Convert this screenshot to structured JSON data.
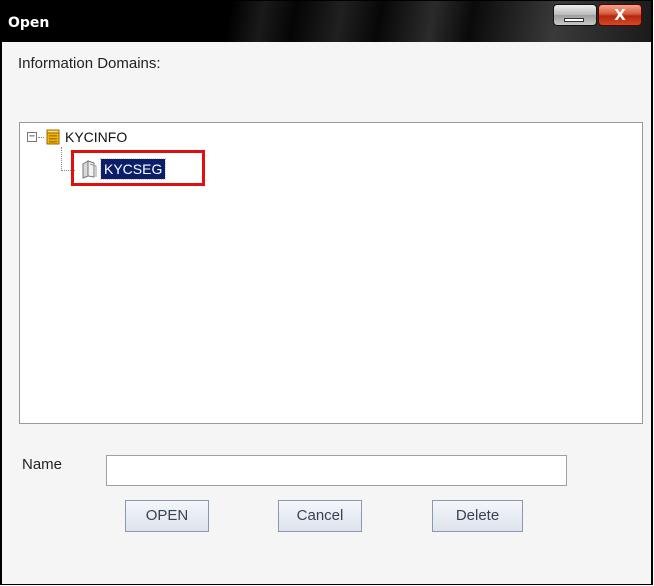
{
  "window": {
    "title": "Open",
    "minimize_icon": "minimize-icon",
    "close_label": "X"
  },
  "domains_label": "Information Domains:",
  "tree": {
    "root": {
      "label": "KYCINFO",
      "icon": "database-icon",
      "expanded": true
    },
    "child": {
      "label": "KYCSEG",
      "icon": "segment-icon",
      "selected": true
    }
  },
  "name_label": "Name",
  "name_input": {
    "value": "",
    "placeholder": ""
  },
  "buttons": {
    "open": "OPEN",
    "cancel": "Cancel",
    "delete": "Delete"
  },
  "colors": {
    "selection": "#0a1e6a",
    "highlight_border": "#e01010"
  }
}
